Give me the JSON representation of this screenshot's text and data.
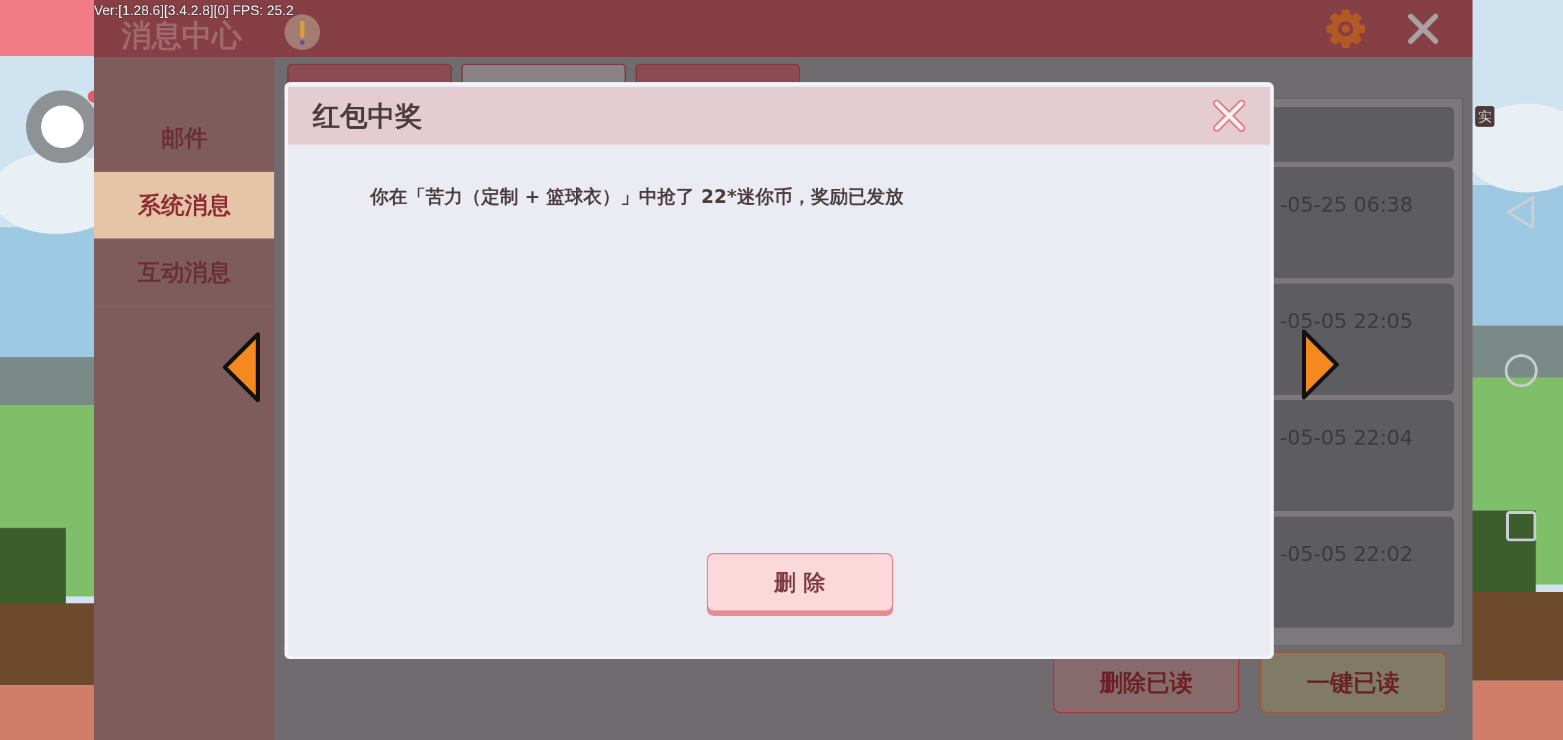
{
  "overlay": {
    "version": "Ver:[1.28.6][3.4.2.8][0] FPS: 25.2",
    "badge": "实"
  },
  "header": {
    "title": "消息中心"
  },
  "sidebar": {
    "items": [
      {
        "label": "邮件",
        "selected": false
      },
      {
        "label": "系统消息",
        "selected": true
      },
      {
        "label": "互动消息",
        "selected": false
      }
    ]
  },
  "tabs": [
    {
      "selected": false
    },
    {
      "selected": true
    },
    {
      "selected": false
    }
  ],
  "messages": [
    {
      "kind": "partial"
    },
    {
      "kind": "full",
      "time": "-05-25 06:38"
    },
    {
      "kind": "full",
      "time": "-05-05 22:05"
    },
    {
      "kind": "full",
      "time": "-05-05 22:04"
    },
    {
      "kind": "full",
      "time": "-05-05 22:02"
    }
  ],
  "actions": [
    {
      "label": "删除已读",
      "kind": "delete"
    },
    {
      "label": "一键已读",
      "kind": "read"
    }
  ],
  "dialog": {
    "title": "红包中奖",
    "message": "你在「苦力（定制 + 篮球衣）」中抢了 22*迷你币，奖励已发放",
    "button": "删 除"
  }
}
